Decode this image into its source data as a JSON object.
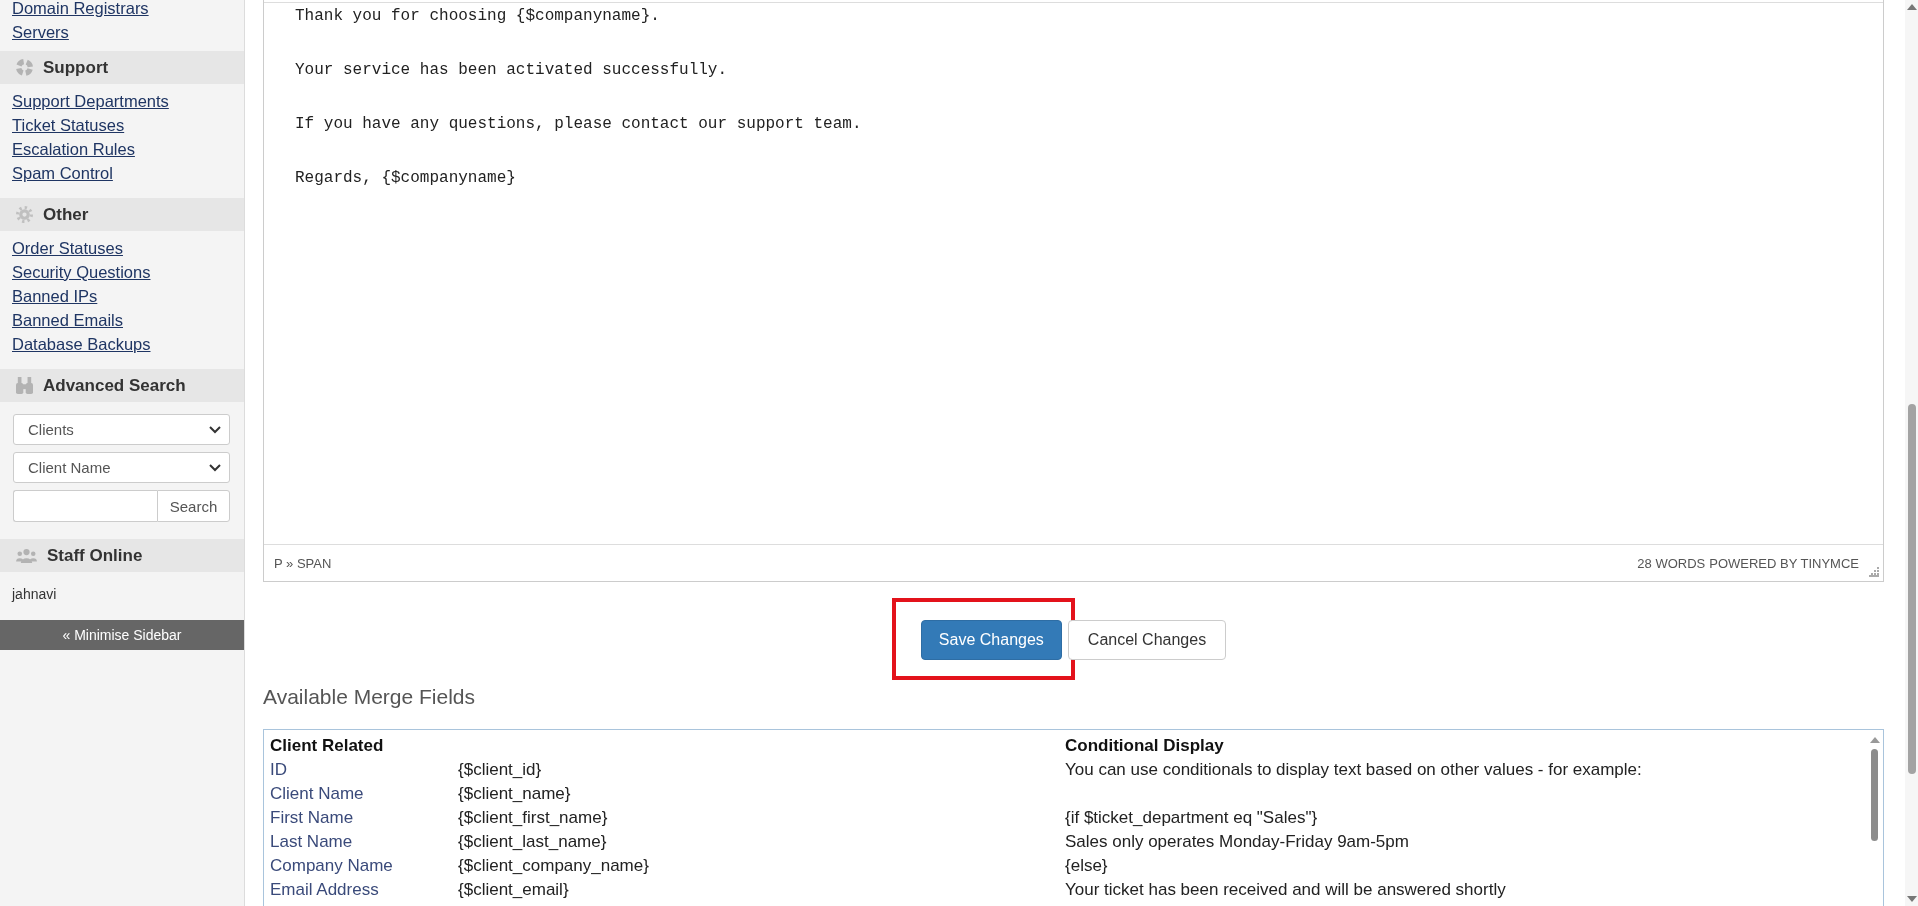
{
  "sidebar": {
    "continued_links": [
      "Domain Registrars",
      "Servers"
    ],
    "sections": [
      {
        "kind": "links",
        "title": "Support",
        "links": [
          "Support Departments",
          "Ticket Statuses",
          "Escalation Rules",
          "Spam Control"
        ]
      },
      {
        "kind": "links",
        "title": "Other",
        "links": [
          "Order Statuses",
          "Security Questions",
          "Banned IPs",
          "Banned Emails",
          "Database Backups"
        ]
      },
      {
        "kind": "search",
        "title": "Advanced Search",
        "selects": [
          "Clients",
          "Client Name"
        ],
        "button": "Search"
      },
      {
        "kind": "staff",
        "title": "Staff Online",
        "staff": [
          "jahnavi"
        ]
      }
    ],
    "minimise": "« Minimise Sidebar"
  },
  "editor": {
    "paragraphs": [
      "Thank you for choosing {$companyname}.",
      "Your service has been activated successfully.",
      "If you have any questions, please contact our support team.",
      "Regards, {$companyname}"
    ],
    "path": "P » SPAN",
    "word_count": "28 WORDS",
    "powered_by": "POWERED BY TINYMCE"
  },
  "actions": [
    {
      "label": "Save Changes",
      "kind": "primary",
      "highlighted": true
    },
    {
      "label": "Cancel Changes",
      "kind": "default",
      "highlighted": false
    }
  ],
  "merge_fields": {
    "title": "Available Merge Fields",
    "client_related": {
      "heading": "Client Related",
      "fields": [
        {
          "label": "ID",
          "tag": "{$client_id}"
        },
        {
          "label": "Client Name",
          "tag": "{$client_name}"
        },
        {
          "label": "First Name",
          "tag": "{$client_first_name}"
        },
        {
          "label": "Last Name",
          "tag": "{$client_last_name}"
        },
        {
          "label": "Company Name",
          "tag": "{$client_company_name}"
        },
        {
          "label": "Email Address",
          "tag": "{$client_email}"
        }
      ]
    },
    "conditional_display": {
      "heading": "Conditional Display",
      "blocks": [
        [
          "You can use conditionals to display text based on other values - for example:"
        ],
        [
          "{if $ticket_department eq \"Sales\"}",
          "Sales only operates Monday-Friday 9am-5pm",
          "{else}",
          "Your ticket has been received and will be answered shortly"
        ]
      ]
    }
  }
}
